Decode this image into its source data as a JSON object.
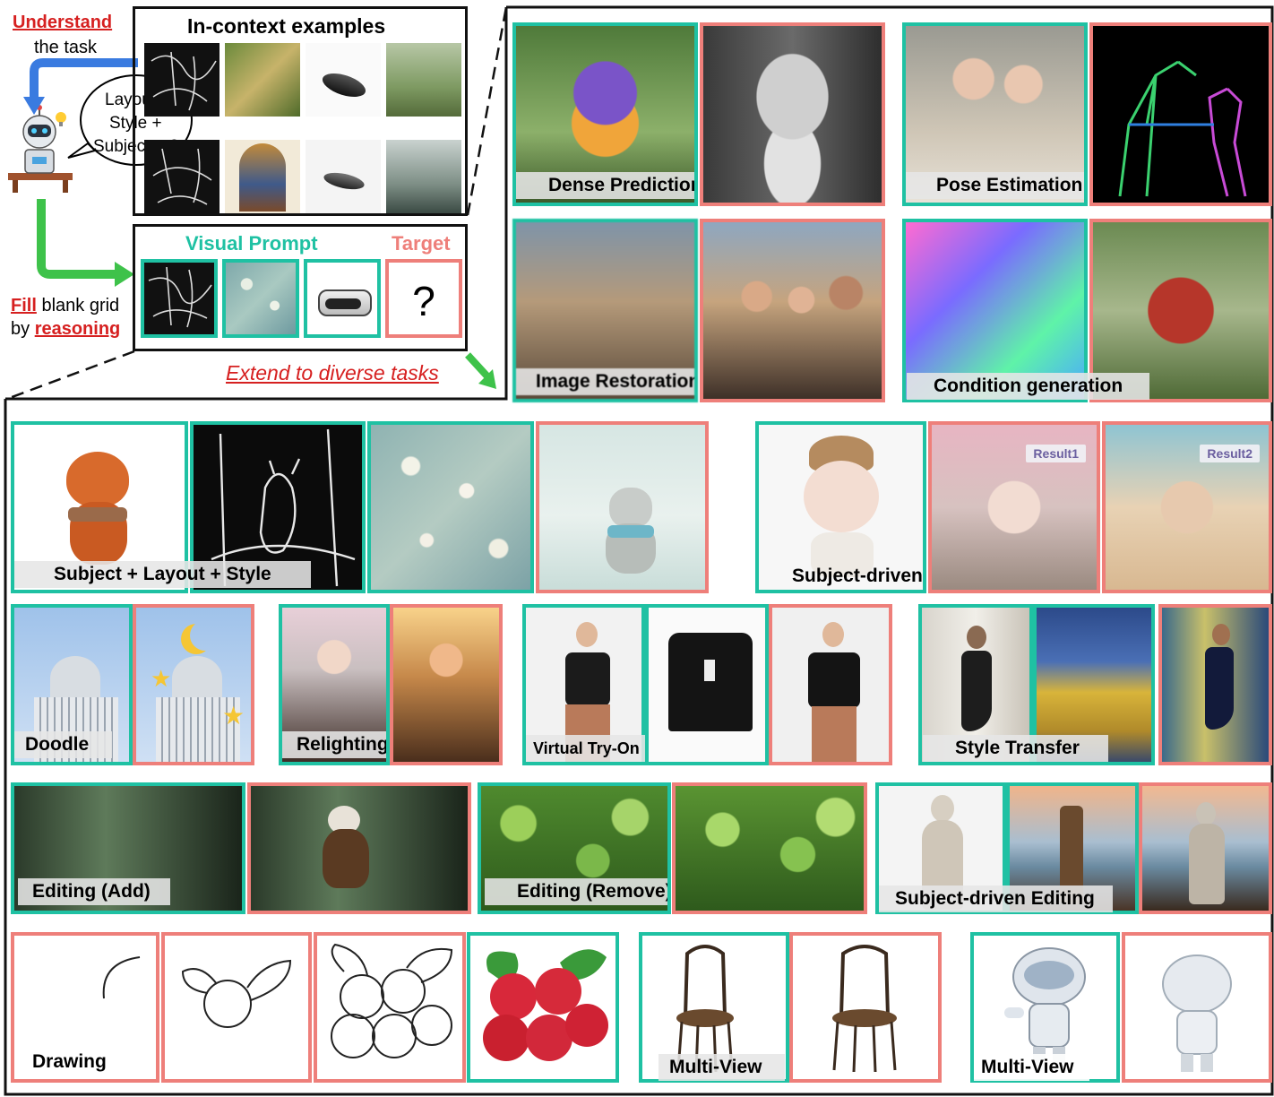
{
  "intro": {
    "understand_word": "Understand",
    "understand_rest": "the task",
    "fill_word": "Fill",
    "fill_rest": "blank grid",
    "by_word": "by",
    "reasoning_word": "reasoning",
    "bubble_lines": [
      "Layout +",
      "Style +",
      "Subject = ?"
    ],
    "in_context_title": "In-context examples",
    "visual_prompt": "Visual Prompt",
    "target": "Target",
    "question_mark": "?",
    "extend": "Extend to diverse tasks"
  },
  "tasks": {
    "dense": "Dense Prediction",
    "pose": "Pose Estimation",
    "restoration": "Image Restoration",
    "condition": "Condition generation",
    "slstyle": "Subject + Layout + Style",
    "subject_driven": "Subject-driven",
    "result1": "Result1",
    "result2": "Result2",
    "doodle": "Doodle",
    "relighting": "Relighting",
    "tryon": "Virtual Try-On",
    "style_transfer": "Style Transfer",
    "edit_add": "Editing (Add)",
    "edit_remove": "Editing (Remove)",
    "subject_edit": "Subject-driven Editing",
    "drawing": "Drawing",
    "multiview1": "Multi-View",
    "multiview2": "Multi-View"
  },
  "colors": {
    "prompt_border": "#1fc1a3",
    "target_border": "#ee7f7a",
    "accent_red": "#d62020",
    "arrow_blue": "#3a7be0",
    "arrow_green": "#3ec24a"
  }
}
